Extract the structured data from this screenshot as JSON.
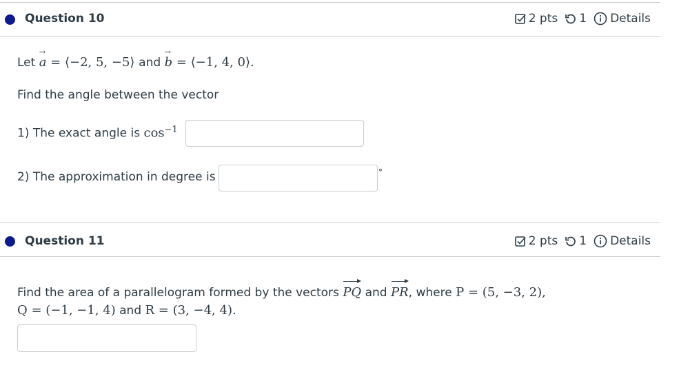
{
  "q10": {
    "title": "Question 10",
    "points": "2 pts",
    "attempts": "1",
    "details": "Details",
    "intro_let": "Let",
    "a_label": "a",
    "a_value": "= ⟨−2, 5, −5⟩",
    "and": "and",
    "b_label": "b",
    "b_value": "= ⟨−1, 4, 0⟩.",
    "prompt": "Find the angle between the vector",
    "part1_label": "1) The exact angle is",
    "part1_func": "cos",
    "part1_sup": "−1",
    "part2_label": "2) The approximation in degree is",
    "degree_symbol": "°"
  },
  "q11": {
    "title": "Question 11",
    "points": "2 pts",
    "attempts": "1",
    "details": "Details",
    "line1_a": "Find the area of a parallelogram formed by the vectors",
    "vec_pq": "PQ",
    "line1_and": "and",
    "vec_pr": "PR",
    "line1_where": ", where",
    "p_def": "P = (5, −3, 2),",
    "q_def": "Q = (−1, −1, 4)",
    "line2_and": "and",
    "r_def": "R = (3, −4, 4)."
  }
}
